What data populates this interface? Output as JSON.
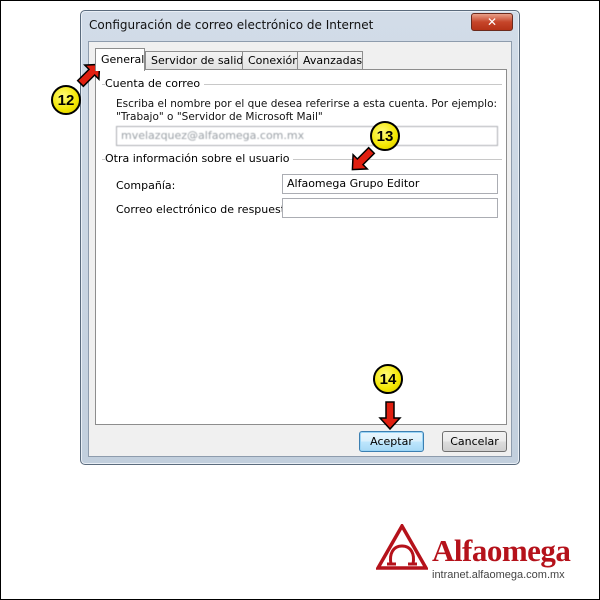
{
  "window": {
    "title": "Configuración de correo electrónico de Internet",
    "close_glyph": "✕"
  },
  "tabs": [
    {
      "label": "General",
      "active": true
    },
    {
      "label": "Servidor de salida",
      "active": false
    },
    {
      "label": "Conexión",
      "active": false
    },
    {
      "label": "Avanzadas",
      "active": false
    }
  ],
  "account_group": {
    "title": "Cuenta de correo",
    "instruction_line1": "Escriba el nombre por el que desea referirse a esta cuenta. Por ejemplo:",
    "instruction_line2": "\"Trabajo\" o \"Servidor de Microsoft Mail\"",
    "account_name_value": "mvelazquez@alfaomega.com.mx"
  },
  "user_group": {
    "title": "Otra información sobre el usuario",
    "company_label": "Compañía:",
    "company_value": "Alfaomega Grupo Editor",
    "reply_email_label": "Correo electrónico de respuesta:",
    "reply_email_value": ""
  },
  "buttons": {
    "accept": "Aceptar",
    "cancel": "Cancelar"
  },
  "callouts": [
    "12",
    "13",
    "14"
  ],
  "brand": {
    "name": "Alfaomega",
    "url": "intranet.alfaomega.com.mx",
    "color": "#b5121b",
    "callout_color": "#f3e600",
    "arrow_color": "#e01f10"
  }
}
